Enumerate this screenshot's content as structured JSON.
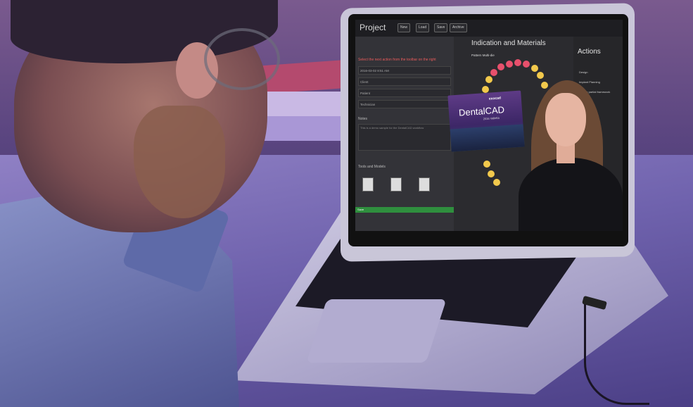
{
  "app": {
    "title": "Project",
    "toolbar": [
      "New",
      "Load",
      "Save",
      "Archive"
    ],
    "warning": "Select the next action from the toolbar on the right",
    "fields": [
      "2016-03-02 8:51 AM",
      "Client",
      "Patient",
      "Technician"
    ],
    "notes_title": "Notes",
    "notes_text": "This is a demo sample for the DentalCAD workflow",
    "tools_title": "Tools and Models",
    "progress_label": "Save"
  },
  "center": {
    "title": "Indication and Materials",
    "arch_label": "Pattern   Multi-die"
  },
  "actions": {
    "title": "Actions",
    "items": [
      "Design",
      "Implant Planning",
      "Design partial framework",
      "Scan",
      "Export"
    ]
  },
  "banner": {
    "brand": "exocad",
    "title": "DentalCAD",
    "sub": "2016 Valletta"
  },
  "colors": {
    "accent": "#e85b5b",
    "progress": "#2f8f3e",
    "tooth_yellow": "#f2c94c",
    "tooth_red": "#e8506c",
    "tooth_green": "#27ae60"
  }
}
